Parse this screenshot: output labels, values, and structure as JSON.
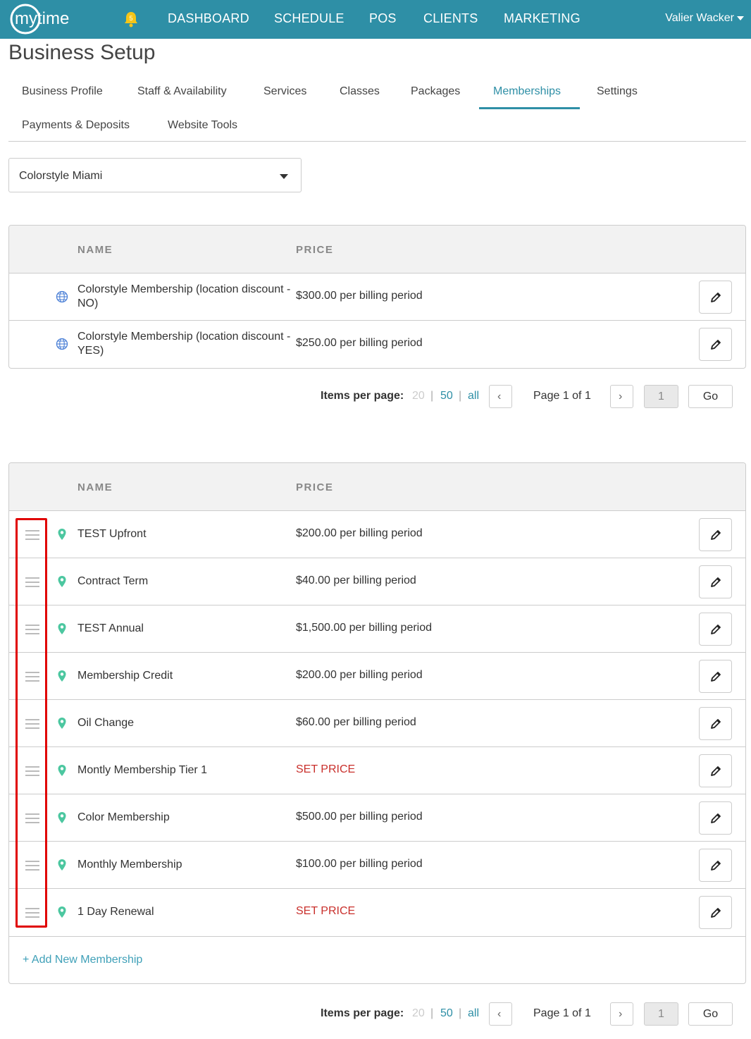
{
  "nav": {
    "logo_text": "mytime",
    "bell_badge": "5",
    "items": [
      "DASHBOARD",
      "SCHEDULE",
      "POS",
      "CLIENTS",
      "MARKETING"
    ],
    "user": "Valier Wacker",
    "bg_color": "#2e8fa6"
  },
  "page_title": "Business Setup",
  "tabs": [
    {
      "label": "Business Profile"
    },
    {
      "label": "Staff & Availability"
    },
    {
      "label": "Services"
    },
    {
      "label": "Classes"
    },
    {
      "label": "Packages"
    },
    {
      "label": "Memberships",
      "active": true
    },
    {
      "label": "Settings"
    },
    {
      "label": "Payments & Deposits"
    },
    {
      "label": "Website Tools"
    }
  ],
  "location_select": {
    "value": "Colorstyle Miami"
  },
  "table1": {
    "headers": {
      "name": "NAME",
      "price": "PRICE"
    },
    "rows": [
      {
        "name": "Colorstyle Membership (location discount - NO)",
        "price": "$300.00 per billing period",
        "icon": "globe-icon"
      },
      {
        "name": "Colorstyle Membership (location discount - YES)",
        "price": "$250.00 per billing period",
        "icon": "globe-icon"
      }
    ]
  },
  "table2": {
    "headers": {
      "name": "NAME",
      "price": "PRICE"
    },
    "rows": [
      {
        "name": "TEST Upfront",
        "price": "$200.00 per billing period",
        "icon": "location-pin-icon"
      },
      {
        "name": "Contract Term",
        "price": "$40.00 per billing period",
        "icon": "location-pin-icon"
      },
      {
        "name": "TEST Annual",
        "price": "$1,500.00 per billing period",
        "icon": "location-pin-icon"
      },
      {
        "name": "Membership Credit",
        "price": "$200.00 per billing period",
        "icon": "location-pin-icon"
      },
      {
        "name": "Oil Change",
        "price": "$60.00 per billing period",
        "icon": "location-pin-icon"
      },
      {
        "name": "Montly Membership Tier 1",
        "price": "SET PRICE",
        "icon": "location-pin-icon",
        "unpriced": true
      },
      {
        "name": "Color Membership",
        "price": "$500.00 per billing period",
        "icon": "location-pin-icon"
      },
      {
        "name": "Monthly Membership",
        "price": "$100.00 per billing period",
        "icon": "location-pin-icon"
      },
      {
        "name": "1 Day Renewal",
        "price": "SET PRICE",
        "icon": "location-pin-icon",
        "unpriced": true
      }
    ],
    "add_link": "+ Add New Membership"
  },
  "pager": {
    "label": "Items per page:",
    "options": [
      "20",
      "50",
      "all"
    ],
    "separator": "|",
    "page_info": "Page 1 of 1",
    "page_value": "1",
    "go_label": "Go",
    "prev": "‹",
    "next": "›"
  },
  "colors": {
    "accent": "#2e8fa6",
    "warn": "#c9302c",
    "pin": "#4cc7a0",
    "highlight": "#e00000"
  }
}
